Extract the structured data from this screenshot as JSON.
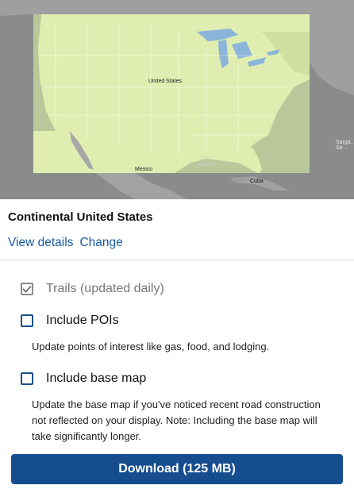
{
  "map": {
    "labels": {
      "united_states": "United States",
      "mexico": "Mexico",
      "gulf": "Gulf of Mexico",
      "cuba": "Cuba",
      "sargasso": "Sarga... Se..."
    },
    "colors": {
      "land_selected": "#dfeeb0",
      "land_outside": "#9e9e9e",
      "water": "#8a8a8a",
      "lakes": "#8ab4d8"
    }
  },
  "region": {
    "title": "Continental United States",
    "view_details": "View details",
    "change": "Change"
  },
  "options": {
    "trails": {
      "label": "Trails (updated daily)",
      "checked": true,
      "disabled": true
    },
    "pois": {
      "label": "Include POIs",
      "checked": false,
      "description": "Update points of interest like gas, food, and lodging."
    },
    "base_map": {
      "label": "Include base map",
      "checked": false,
      "description": "Update the base map if you've noticed recent road construction not reflected on your display. Note: Including the base map will take significantly longer."
    }
  },
  "download": {
    "label": "Download (125 MB)"
  },
  "theme": {
    "accent": "#164d8e",
    "link": "#1a5aa0"
  }
}
